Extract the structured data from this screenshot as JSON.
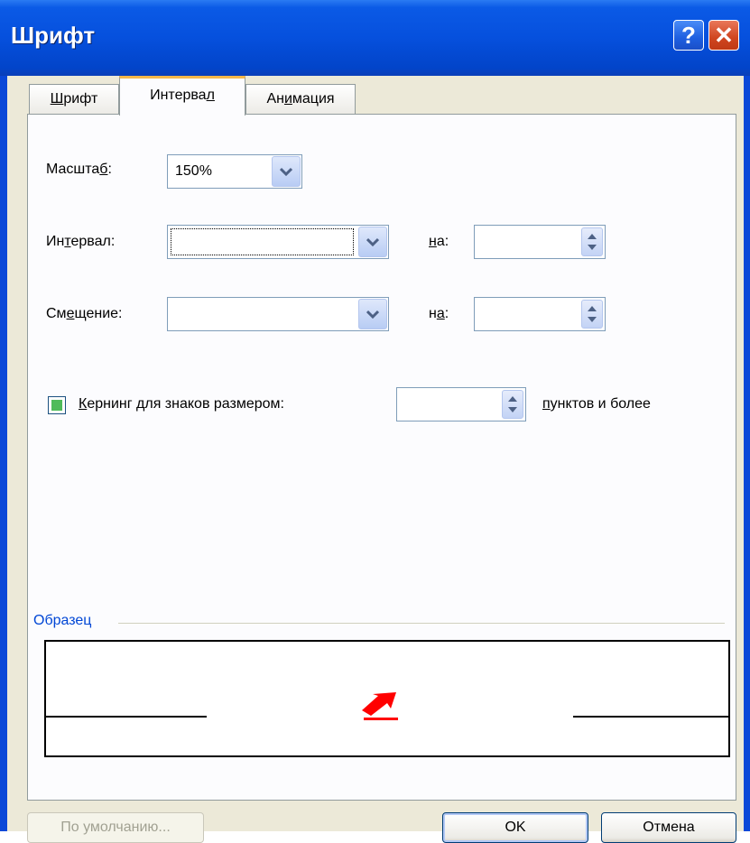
{
  "window": {
    "title": "Шрифт",
    "help_glyph": "?",
    "close_glyph": "✕"
  },
  "tabs": [
    {
      "label": "Шрифт",
      "accel": "Ш",
      "rest": "рифт",
      "active": false
    },
    {
      "label": "Интервал",
      "pre": "Интерва",
      "accel": "л",
      "active": true
    },
    {
      "label": "Анимация",
      "pre": "Ан",
      "accel": "и",
      "rest": "мация",
      "active": false
    }
  ],
  "scale": {
    "label_pre": "Масшта",
    "label_accel": "б",
    "label_post": ":",
    "value": "150%"
  },
  "spacing": {
    "label_pre": "Ин",
    "label_accel": "т",
    "label_post": "ервал:",
    "value": "",
    "by_accel": "н",
    "by_post": "а:",
    "by_value": ""
  },
  "position": {
    "label_pre": "См",
    "label_accel": "е",
    "label_post": "щение:",
    "value": "",
    "by_pre": "н",
    "by_accel": "а",
    "by_post": ":",
    "by_value": ""
  },
  "kerning": {
    "checked": true,
    "label_accel": "К",
    "label_post": "ернинг для знаков размером:",
    "value": "",
    "suffix_accel": "п",
    "suffix_post": "унктов и более"
  },
  "preview": {
    "title": "Образец"
  },
  "buttons": {
    "default_label": "По умолчанию...",
    "ok_label": "OK",
    "cancel_label": "Отмена"
  },
  "colors": {
    "titlebar": "#0650dd",
    "accent_tab": "#f6b84a",
    "preview_arrow": "#ff0000",
    "group_title": "#0046d5"
  }
}
